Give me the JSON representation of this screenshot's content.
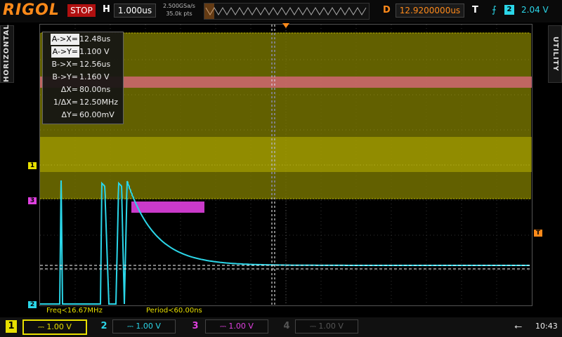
{
  "brand": "RIGOL",
  "top": {
    "status": "STOP",
    "h_label": "H",
    "h_scale": "1.000us",
    "sample_rate": "2.500GSa/s",
    "mem_depth": "35.0k pts",
    "d_label": "D",
    "delay": "12.9200000us",
    "t_label": "T",
    "trigger_channel": "2",
    "trigger_level": "2.04 V"
  },
  "side": {
    "left": "HORIZONTAL",
    "right": "UTILITY"
  },
  "cursors": [
    {
      "key": "A->X=",
      "value": "12.48us",
      "highlight": true
    },
    {
      "key": "A->Y=",
      "value": "1.100 V",
      "highlight": true
    },
    {
      "key": "B->X=",
      "value": "12.56us",
      "highlight": false
    },
    {
      "key": "B->Y=",
      "value": "1.160 V",
      "highlight": false
    },
    {
      "key": "ΔX=",
      "value": "80.00ns",
      "highlight": false
    },
    {
      "key": "1/ΔX=",
      "value": "12.50MHz",
      "highlight": false
    },
    {
      "key": "ΔY=",
      "value": "60.00mV",
      "highlight": false
    }
  ],
  "measure": {
    "freq": "Freq≺16.67MHz",
    "period": "Period≺60.00ns"
  },
  "markers": {
    "ch1": "1",
    "ch3": "3",
    "ch2": "2",
    "trig": "T"
  },
  "channels": [
    {
      "num": "1",
      "scale": "1.00 V"
    },
    {
      "num": "2",
      "scale": "1.00 V"
    },
    {
      "num": "3",
      "scale": "1.00 V"
    },
    {
      "num": "4",
      "scale": "1.00 V"
    }
  ],
  "clock": "10:43",
  "colors": {
    "ch1": "#e8e000",
    "ch2": "#2bd6e8",
    "ch3": "#e040e0",
    "ch4": "#555555",
    "brand": "#ff8a1a"
  }
}
